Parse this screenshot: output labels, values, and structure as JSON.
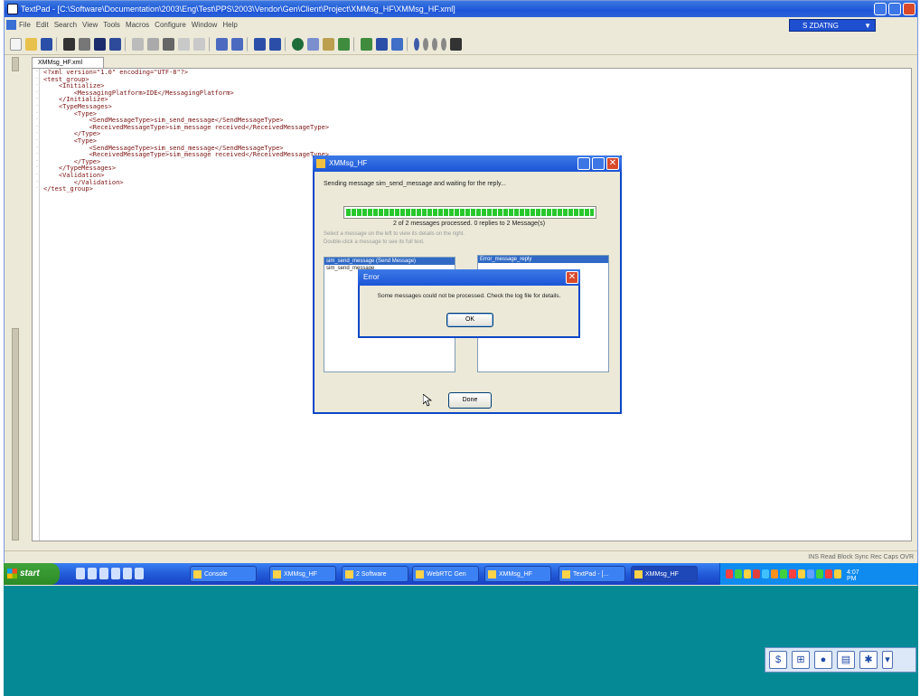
{
  "window": {
    "title": "TextPad - [C:\\Software\\Documentation\\2003\\Eng\\Test\\PPS\\2003\\Vendor\\Gen\\Client\\Project\\XMMsg_HF\\XMMsg_HF.xml]"
  },
  "menubar": {
    "items": [
      "File",
      "Edit",
      "Search",
      "View",
      "Tools",
      "Macros",
      "Configure",
      "Window",
      "Help"
    ]
  },
  "config_dropdown": {
    "value": "S ZDATNG"
  },
  "editor": {
    "tab_label": "XMMsg_HF.xml",
    "code_lines": [
      "<?xml version=\"1.0\" encoding=\"UTF-8\"?>",
      "<test_group>",
      "    <Initialize>",
      "        <MessagingPlatform>IDE</MessagingPlatform>",
      "    </Initialize>",
      "    <TypeMessages>",
      "        <Type>",
      "            <SendMessageType>sim_send_message</SendMessageType>",
      "            <ReceivedMessageType>sim_message received</ReceivedMessageType>",
      "        </Type>",
      "        <Type>",
      "            <SendMessageType>sim_send_message</SendMessageType>",
      "            <ReceivedMessageType>sim_message received</ReceivedMessageType>",
      "        </Type>",
      "    </TypeMessages>",
      "    <Validation>",
      "        </Validation>",
      "</test_group>"
    ]
  },
  "statusbar": {
    "text": "INS  Read  Block  Sync  Rec  Caps",
    "position": "OVR"
  },
  "taskbar": {
    "start_label": "start",
    "tasks": [
      {
        "label": "Console",
        "active": false
      },
      {
        "label": "XMMsg_HF",
        "active": false
      },
      {
        "label": "2 Software",
        "active": false
      },
      {
        "label": "WebRTC Gen",
        "active": false
      },
      {
        "label": "XMMsg_HF",
        "active": false
      },
      {
        "label": "TextPad - [...",
        "active": false
      },
      {
        "label": "XMMsg_HF",
        "active": true
      }
    ],
    "clock": "4:07 PM"
  },
  "progress_dialog": {
    "title": "XMMsg_HF",
    "message": "Sending message sim_send_message and waiting for the reply...",
    "progress_percent": 100,
    "count_text": "2 of 2 messages processed. 0 replies to 2 Message(s)",
    "info_line_1": "Select a message on the left to view its details on the right.",
    "info_line_2": "Double-click a message to see its full text.",
    "left_list": [
      "sim_send_message (Send Message)",
      "sim_send_message"
    ],
    "right_list": [
      "Error_message_reply"
    ],
    "done_label": "Done"
  },
  "error_dialog": {
    "title": "Error",
    "message": "Some messages could not be processed. Check the log file for details.",
    "ok_label": "OK"
  },
  "colors": {
    "titlebar": "#1c55d8",
    "desktop": "#058a95",
    "progress_fill": "#28c82c",
    "close_button": "#d84a2a"
  }
}
